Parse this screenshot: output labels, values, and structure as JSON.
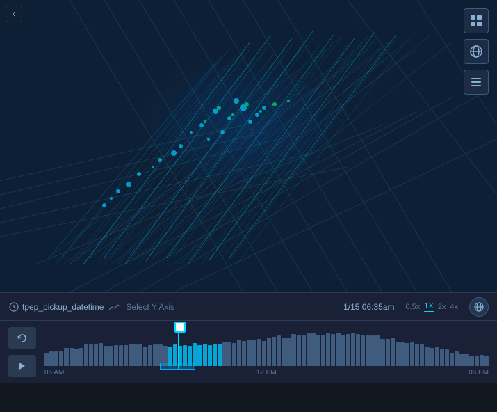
{
  "map": {
    "background": "#0d1f35"
  },
  "toolbar": {
    "datetime_field": "tpep_pickup_datetime",
    "select_y_label": "Select Y Axis",
    "timestamp": "1/15 06:35am",
    "speeds": [
      {
        "value": "0.5x",
        "active": false
      },
      {
        "value": "1X",
        "active": true
      },
      {
        "value": "2x",
        "active": false
      },
      {
        "value": "4x",
        "active": false
      }
    ]
  },
  "timeline": {
    "time_labels": [
      "06 AM",
      "12 PM",
      "06 PM"
    ],
    "replay_label": "↺",
    "play_label": "▶"
  },
  "icons": {
    "grid": "⊞",
    "globe": "◎",
    "list": "≡",
    "back": "‹",
    "clock": "⏱",
    "trend": "∿",
    "refresh": "↺"
  }
}
